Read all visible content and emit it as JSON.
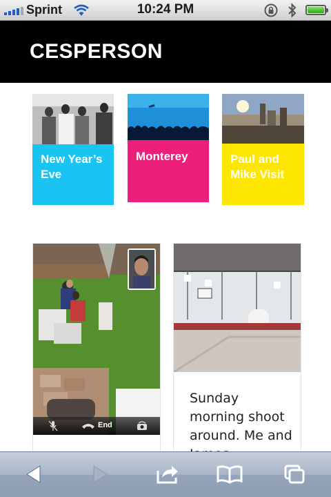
{
  "status_bar": {
    "carrier": "Sprint",
    "time": "10:24 PM",
    "signal_bars": 4,
    "battery_level": 1.0,
    "icons": [
      "signal-icon",
      "wifi-icon",
      "rotation-lock-icon",
      "bluetooth-icon",
      "battery-icon"
    ]
  },
  "header": {
    "title": "CESPERSON",
    "background": "#000000"
  },
  "albums": [
    {
      "label": "New Year’s Eve",
      "color": "#1ac4f2"
    },
    {
      "label": "Monterey",
      "color": "#ec1f7a"
    },
    {
      "label": "Paul and Mike Visit",
      "color": "#fde600"
    }
  ],
  "posts": [
    {
      "call_end_label": "End"
    },
    {
      "text": "Sunday morning shoot around. Me and James"
    }
  ],
  "toolbar": {
    "icons": [
      "back-icon",
      "forward-icon",
      "share-icon",
      "bookmarks-icon",
      "tabs-icon"
    ],
    "forward_enabled": false
  }
}
